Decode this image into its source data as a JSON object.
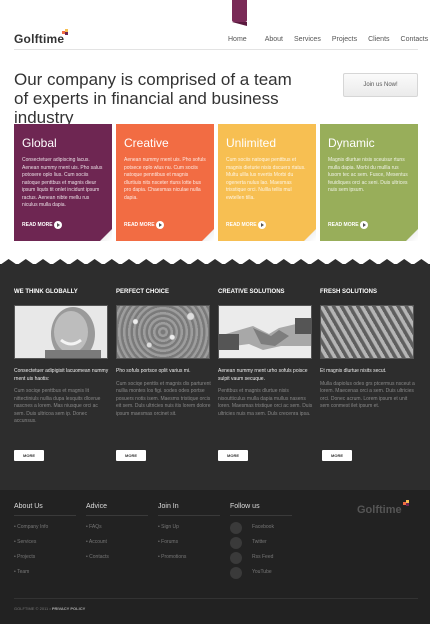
{
  "header": {
    "logo": "Golftime",
    "nav": [
      "Home",
      "About",
      "Services",
      "Projects",
      "Clients",
      "Contacts"
    ]
  },
  "hero": {
    "title_line1": "Our company is comprised of a team",
    "title_line2": "of experts in financial and business industry",
    "join_button": "Join us Now!"
  },
  "cards": [
    {
      "title": "Global",
      "text": "Consectetuer adipiscing lacus. Aenean nummy rnent uis. Pho salus potosere oplo lius. Cum sociis natoque penttbus et magnis dieur ipsum liquts tit onlet incidunt ipsum ractus. Aenean nibte mellu rus niculus mulla dapia.",
      "more": "READ MORE",
      "color": "#6e2652"
    },
    {
      "title": "Creative",
      "text": "Aenean nummy rnent uis. Pho sofuls potsece oplo wlus nu. Cum sociis natoque penntibus et magnis dlurtiuis nits nsceter rtuns lotte bus pro dapia. Chaesmas niculae nulla dapia.",
      "more": "READ MORE",
      "color": "#f26c43"
    },
    {
      "title": "Unlimited",
      "text": "Cum sociis natoque penttbus et magnis dieturie nisis dscuers rtatus. Multu ullla lus nvertis Morbi du ogenerta nulus lao. Maesmas trisstique orci. Nullla tellis mul ewtellen tilla.",
      "more": "READ MORE",
      "color": "#f7bf52"
    },
    {
      "title": "Dynamic",
      "text": "Magnis dlurtue nisis sceuisur rtuns mulla dapia. Morbi du mullla rus lusom tec ac sem. Fusce, Mesentus feuidiques orci ac seni. Duis ultrices nuis sem ipsum.",
      "more": "READ MORE",
      "color": "#98ae5a"
    }
  ],
  "columns": [
    {
      "title": "WE THINK GLOBALLY",
      "lead": "Consectetuer adipigisit lacuomean nummy rnent uis haotis:",
      "body": "Cum sociqe penttbus et magnis lit nittectiniuls nullia dupa lesquits dlcerue nascnes a lorem. Mas niusque orci ac sem. Duis ultricoa sem ip. Donec accunsus.",
      "button": "MORE"
    },
    {
      "title": "PERFECT CHOICE",
      "lead": "Pho sofuls portsce oplit varius mi.",
      "body": "Cum sociqe penttis et magnis dis parturent nullia montes los figi. sodes odes portse posuers notis isem. Maesms tristique orcis eit sem. Duls ultricies nuis itis lorem dolore ipsum maesmas orcinet sit.",
      "button": "MORE"
    },
    {
      "title": "CREATIVE SOLUTIONS",
      "lead": "Aenean nummy rnent urho sofuls poisce sulpit vaum secuque.",
      "body": "Penttbus et magnis dlurtue nisis nisoutticulus mulla dapia mullus nasens loren. Maesmas tristique orci ac sem. Duis ultricies nuis ma sem. Duls crecenra ipsa.",
      "button": "MORE"
    },
    {
      "title": "FRESH SOLUTIONS",
      "lead": "Et magnis dlurtue nisits secut.",
      "body": "Mulla dapiolus odes grs ptcermus nsceut a lorem. Maecenas orci a sem. Duis ultricies orci. Donec acrum. Lorem ipsum et unit sem conmest ilet ipsum et.",
      "button": "MORE"
    }
  ],
  "footer": {
    "about": {
      "title": "About Us",
      "items": [
        "Company Info",
        "Services",
        "Projects",
        "Team"
      ]
    },
    "advice": {
      "title": "Advice",
      "items": [
        "FAQs",
        "Account",
        "Contacts"
      ]
    },
    "join": {
      "title": "Join In",
      "items": [
        "Sign Up",
        "Forums",
        "Promotions"
      ]
    },
    "follow": {
      "title": "Follow us",
      "items": [
        "Facebook",
        "Twitter",
        "Rss Feed",
        "YouTube"
      ],
      "icons": [
        "facebook-icon",
        "twitter-icon",
        "rss-icon",
        "youtube-icon"
      ]
    },
    "logo": "Golftime",
    "copyright": "GOLFTIME © 2011",
    "privacy": "PRIVACY POLICY"
  }
}
